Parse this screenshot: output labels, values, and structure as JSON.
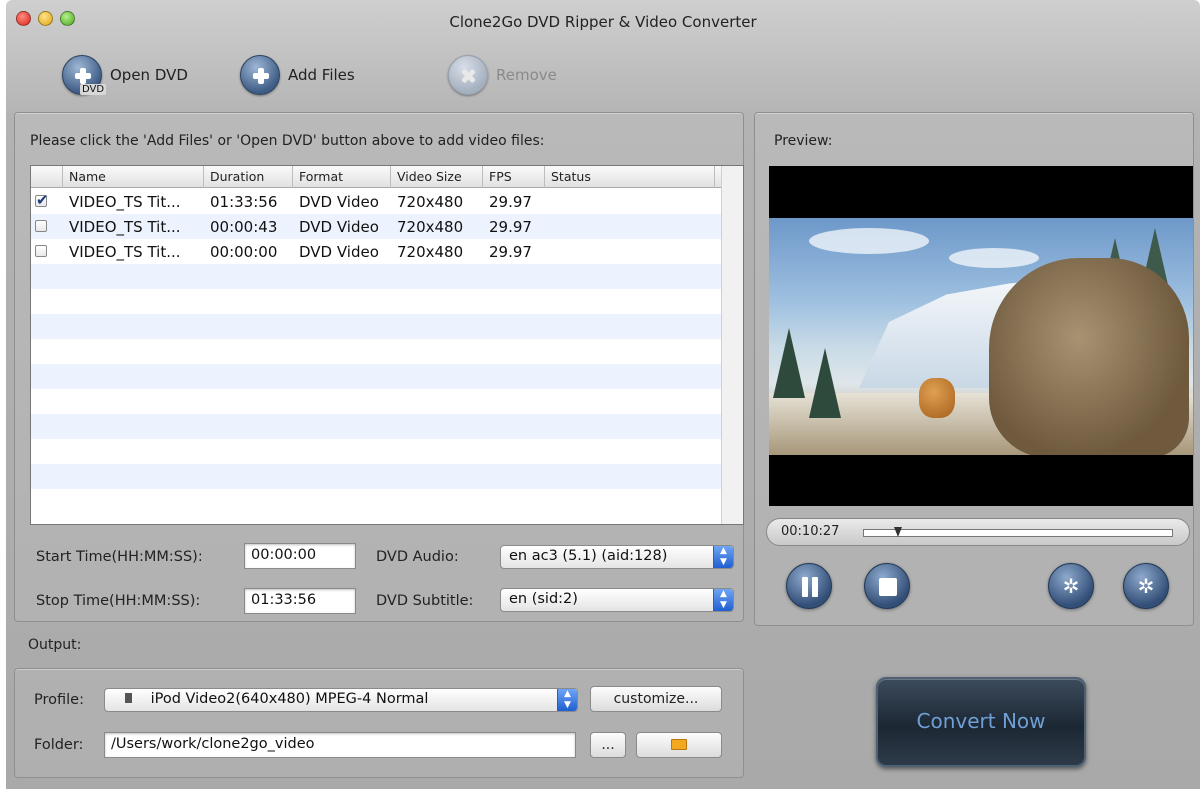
{
  "window": {
    "title": "Clone2Go DVD Ripper & Video Converter"
  },
  "toolbar": {
    "open_dvd": "Open DVD",
    "open_dvd_badge": "DVD",
    "add_files": "Add Files",
    "remove": "Remove"
  },
  "files": {
    "hint": "Please click the 'Add Files' or 'Open DVD' button above to add video files:",
    "columns": [
      "Name",
      "Duration",
      "Format",
      "Video Size",
      "FPS",
      "Status"
    ],
    "rows": [
      {
        "checked": true,
        "name": "VIDEO_TS Tit...",
        "duration": "01:33:56",
        "format": "DVD Video",
        "size": "720x480",
        "fps": "29.97",
        "status": ""
      },
      {
        "checked": false,
        "name": "VIDEO_TS Tit...",
        "duration": "00:00:43",
        "format": "DVD Video",
        "size": "720x480",
        "fps": "29.97",
        "status": ""
      },
      {
        "checked": false,
        "name": "VIDEO_TS Tit...",
        "duration": "00:00:00",
        "format": "DVD Video",
        "size": "720x480",
        "fps": "29.97",
        "status": ""
      }
    ]
  },
  "trim": {
    "start_label": "Start Time(HH:MM:SS):",
    "start_value": "00:00:00",
    "stop_label": "Stop Time(HH:MM:SS):",
    "stop_value": "01:33:56"
  },
  "dvd": {
    "audio_label": "DVD Audio:",
    "audio_value": "en ac3 (5.1) (aid:128)",
    "subtitle_label": "DVD Subtitle:",
    "subtitle_value": "en (sid:2)"
  },
  "preview": {
    "label": "Preview:",
    "time": "00:10:27",
    "position_fraction": 0.1
  },
  "output": {
    "label": "Output:",
    "profile_label": "Profile:",
    "profile_value": "iPod Video2(640x480) MPEG-4 Normal",
    "customize": "customize...",
    "folder_label": "Folder:",
    "folder_value": "/Users/work/clone2go_video",
    "browse": "..."
  },
  "convert": {
    "label": "Convert Now"
  },
  "icons": {
    "open_dvd": "add-circle-icon",
    "add_files": "add-circle-icon",
    "remove": "remove-circle-icon",
    "pause": "pause-icon",
    "stop": "stop-icon",
    "snapshot": "snapshot-icon",
    "settings": "settings-icon",
    "folder": "folder-icon"
  },
  "colors": {
    "accent": "#1f5fd0",
    "convert_text": "#6f9fd4"
  }
}
